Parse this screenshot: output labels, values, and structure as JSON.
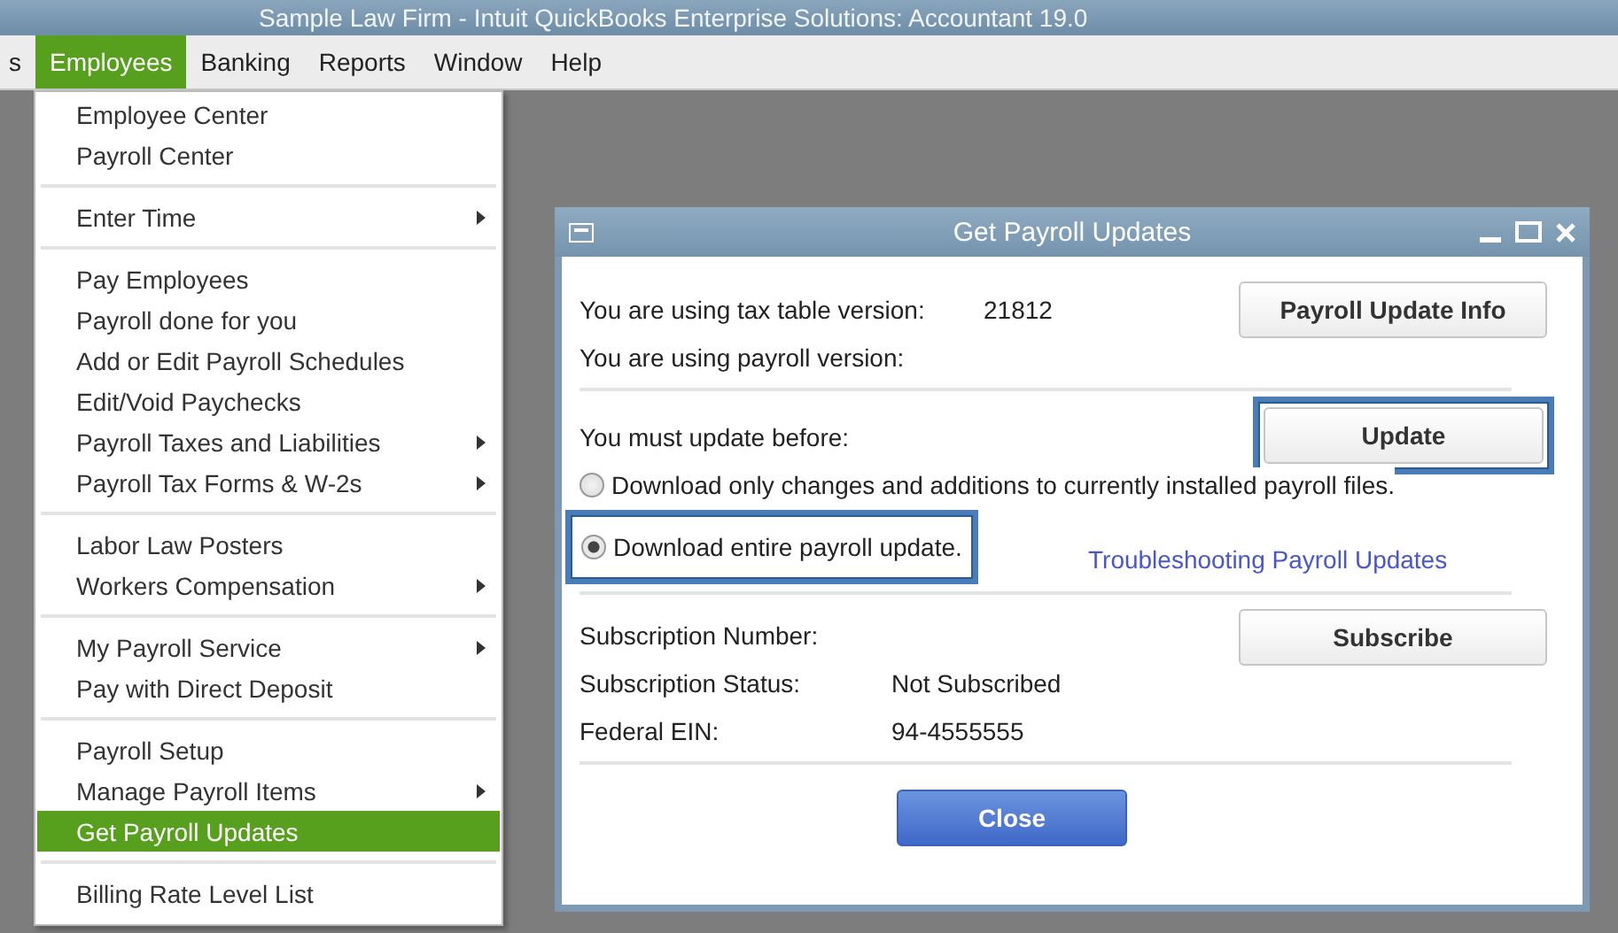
{
  "app_title": "Sample Law Firm  - Intuit QuickBooks Enterprise Solutions: Accountant 19.0",
  "menubar": [
    {
      "label": "s",
      "selected": false
    },
    {
      "label": "Employees",
      "selected": true
    },
    {
      "label": "Banking",
      "selected": false
    },
    {
      "label": "Reports",
      "selected": false
    },
    {
      "label": "Window",
      "selected": false
    },
    {
      "label": "Help",
      "selected": false
    }
  ],
  "menu_groups": [
    [
      {
        "label": "Employee Center",
        "submenu": false,
        "selected": false
      },
      {
        "label": "Payroll Center",
        "submenu": false,
        "selected": false
      }
    ],
    [
      {
        "label": "Enter Time",
        "submenu": true,
        "selected": false
      }
    ],
    [
      {
        "label": "Pay Employees",
        "submenu": false,
        "selected": false
      },
      {
        "label": "Payroll done for you",
        "submenu": false,
        "selected": false
      },
      {
        "label": "Add or Edit Payroll Schedules",
        "submenu": false,
        "selected": false
      },
      {
        "label": "Edit/Void Paychecks",
        "submenu": false,
        "selected": false
      },
      {
        "label": "Payroll Taxes and Liabilities",
        "submenu": true,
        "selected": false
      },
      {
        "label": "Payroll Tax Forms & W-2s",
        "submenu": true,
        "selected": false
      }
    ],
    [
      {
        "label": "Labor Law Posters",
        "submenu": false,
        "selected": false
      },
      {
        "label": "Workers Compensation",
        "submenu": true,
        "selected": false
      }
    ],
    [
      {
        "label": "My Payroll Service",
        "submenu": true,
        "selected": false
      },
      {
        "label": "Pay with Direct Deposit",
        "submenu": false,
        "selected": false
      }
    ],
    [
      {
        "label": "Payroll Setup",
        "submenu": false,
        "selected": false
      },
      {
        "label": "Manage Payroll Items",
        "submenu": true,
        "selected": false
      },
      {
        "label": "Get Payroll Updates",
        "submenu": false,
        "selected": true
      }
    ],
    [
      {
        "label": "Billing Rate Level List",
        "submenu": false,
        "selected": false
      }
    ]
  ],
  "dialog": {
    "title": "Get Payroll Updates",
    "version_rows": [
      {
        "label": "You are using tax table version:",
        "value": "21812"
      },
      {
        "label": "You are using payroll version:"
      }
    ],
    "info_button": {
      "label": "Payroll Update Info"
    },
    "update_label": "You must update before:",
    "update_button": {
      "label": "Update",
      "highlighted": true
    },
    "options": [
      {
        "label": "Download only changes and additions to currently installed payroll files.",
        "selected": false,
        "highlighted": false
      },
      {
        "label": "Download entire payroll update.",
        "selected": true,
        "highlighted": true
      }
    ],
    "link": "Troubleshooting Payroll Updates",
    "subscription_rows": [
      {
        "label": "Subscription Number:"
      },
      {
        "label": "Subscription Status:",
        "value": "Not Subscribed"
      },
      {
        "label": "Federal EIN:",
        "value": "94-4555555"
      }
    ],
    "subscribe_button": {
      "label": "Subscribe"
    },
    "close_button": "Close"
  }
}
